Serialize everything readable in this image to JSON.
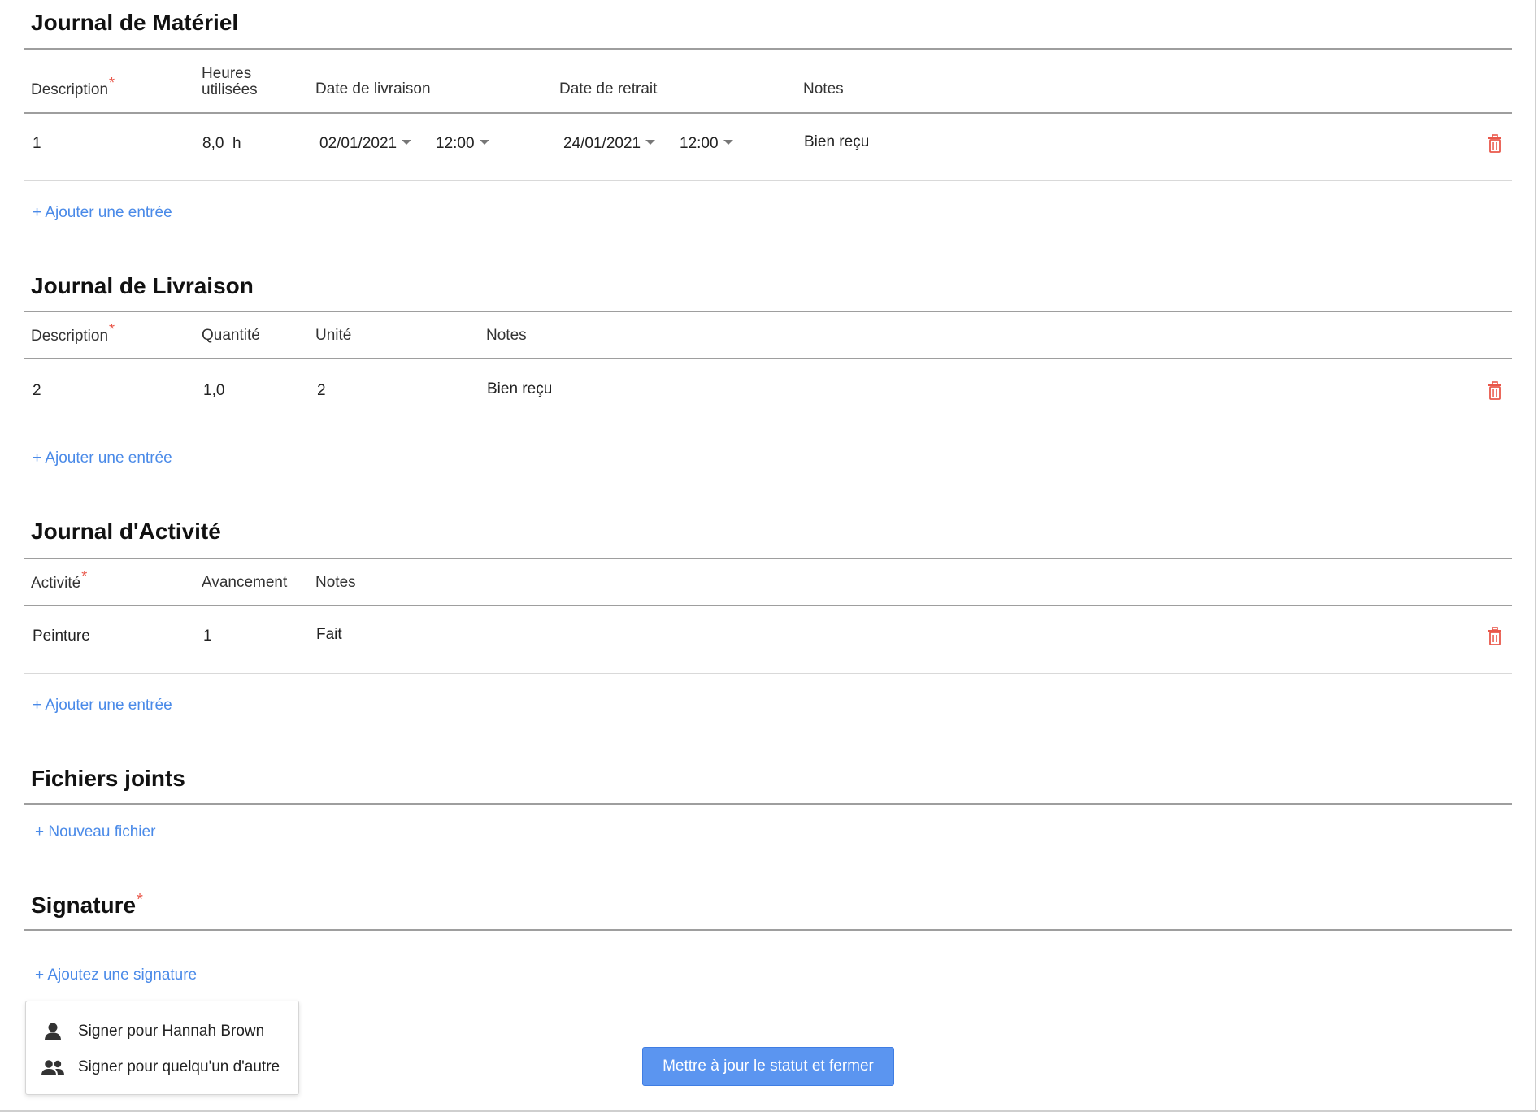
{
  "required_mark": "*",
  "material_log": {
    "title": "Journal de Matériel",
    "columns": {
      "description": "Description",
      "hours_line1": "Heures",
      "hours_line2": "utilisées",
      "delivery_date": "Date de livraison",
      "pickup_date": "Date de retrait",
      "notes": "Notes"
    },
    "rows": [
      {
        "description": "1",
        "hours": "8,0",
        "hours_unit": "h",
        "delivery_date": "02/01/2021",
        "delivery_time": "12:00",
        "pickup_date": "24/01/2021",
        "pickup_time": "12:00",
        "notes": "Bien reçu"
      }
    ],
    "add_entry": "+ Ajouter une entrée"
  },
  "delivery_log": {
    "title": "Journal de Livraison",
    "columns": {
      "description": "Description",
      "quantity": "Quantité",
      "unit": "Unité",
      "notes": "Notes"
    },
    "rows": [
      {
        "description": "2",
        "quantity": "1,0",
        "unit": "2",
        "notes": "Bien reçu"
      }
    ],
    "add_entry": "+ Ajouter une entrée"
  },
  "activity_log": {
    "title": "Journal d'Activité",
    "columns": {
      "activity": "Activité",
      "progress": "Avancement",
      "notes": "Notes"
    },
    "rows": [
      {
        "activity": "Peinture",
        "progress": "1",
        "notes": "Fait"
      }
    ],
    "add_entry": "+ Ajouter une entrée"
  },
  "attachments": {
    "title": "Fichiers joints",
    "new_file": "+ Nouveau fichier"
  },
  "signature": {
    "title": "Signature",
    "add_signature": "+ Ajoutez une signature",
    "menu": {
      "sign_self": "Signer pour Hannah Brown",
      "sign_other": "Signer pour quelqu'un d'autre"
    }
  },
  "footer": {
    "submit_label": "Mettre à jour le statut et fermer"
  },
  "icons": {
    "delete": "trash-icon",
    "person": "person-icon",
    "people": "people-icon",
    "dropdown": "caret-down-icon"
  },
  "colors": {
    "link": "#4a8ae8",
    "required": "#e9574a",
    "delete_icon": "#e9574a",
    "primary_button": "#5b95f0"
  }
}
